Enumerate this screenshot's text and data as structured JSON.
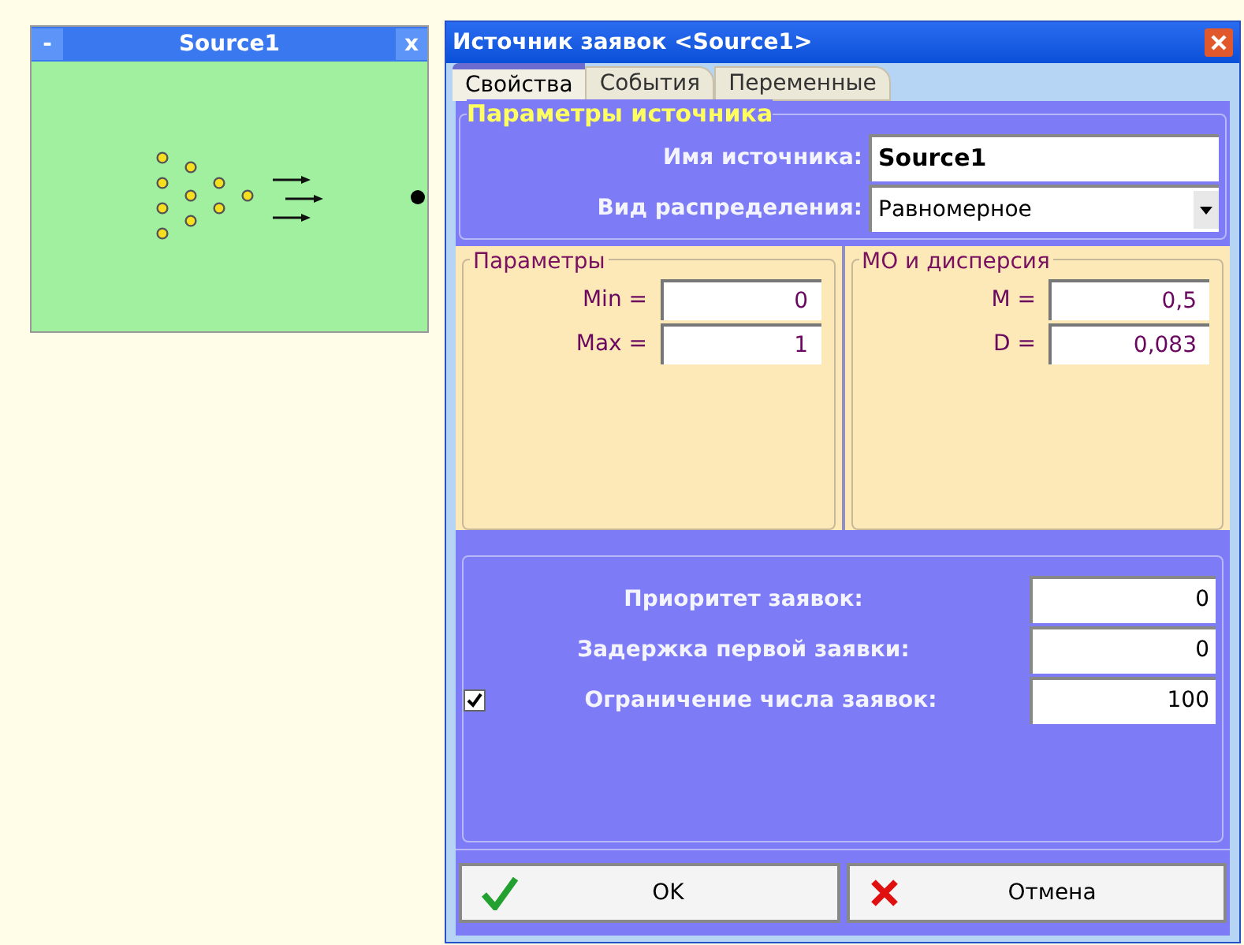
{
  "source_window": {
    "title": "Source1",
    "minimize": "-",
    "close": "x"
  },
  "dialog": {
    "title": "Источник заявок <Source1>",
    "tabs": [
      {
        "label": "Свойства",
        "selected": true
      },
      {
        "label": "События",
        "selected": false
      },
      {
        "label": "Переменные",
        "selected": false
      }
    ],
    "source_params": {
      "legend": "Параметры источника",
      "name_label": "Имя источника:",
      "name_value": "Source1",
      "distribution_label": "Вид распределения:",
      "distribution_value": "Равномерное"
    },
    "params": {
      "legend": "Параметры",
      "fields": [
        {
          "label": "Min =",
          "value": "0"
        },
        {
          "label": "Max =",
          "value": "1"
        }
      ]
    },
    "moments": {
      "legend": "МО и дисперсия",
      "fields": [
        {
          "label": "M =",
          "value": "0,5"
        },
        {
          "label": "D =",
          "value": "0,083"
        }
      ]
    },
    "options": [
      {
        "label": "Приоритет заявок:",
        "value": "0",
        "kind": "plain"
      },
      {
        "label": "Задержка первой заявки:",
        "value": "0",
        "kind": "plain"
      },
      {
        "label": "Ограничение числа заявок:",
        "value": "100",
        "kind": "checkbox",
        "checked": true
      }
    ],
    "buttons": [
      {
        "label": "OK",
        "kind": "ok"
      },
      {
        "label": "Отмена",
        "kind": "cancel"
      }
    ]
  }
}
